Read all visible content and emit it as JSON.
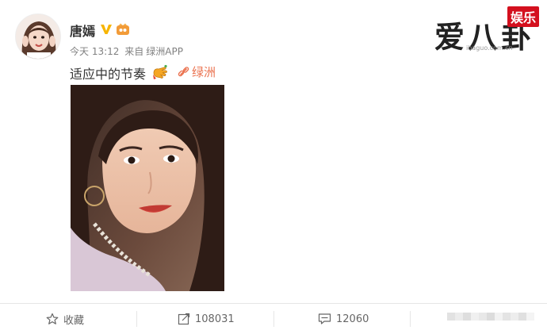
{
  "post": {
    "author": "唐嫣",
    "time": "今天 13:12",
    "source_prefix": "来自",
    "source": "绿洲APP",
    "text": "适应中的节奏",
    "link_label": "绿洲"
  },
  "actions": {
    "favorite": "收藏",
    "repost": "108031",
    "comment": "12060"
  },
  "watermark": {
    "brand": "爱八卦",
    "tag": "娱乐",
    "url": "ibaguo.com.cn"
  },
  "colors": {
    "link": "#eb7350",
    "verified": "#f7b500",
    "watermark_tag": "#d4101e"
  },
  "icons": {
    "verified": "verified-v-icon",
    "level": "level-badge-icon",
    "emoji": "hand-emoji-icon",
    "link": "link-icon",
    "favorite": "star-icon",
    "repost": "repost-icon",
    "comment": "comment-icon"
  }
}
